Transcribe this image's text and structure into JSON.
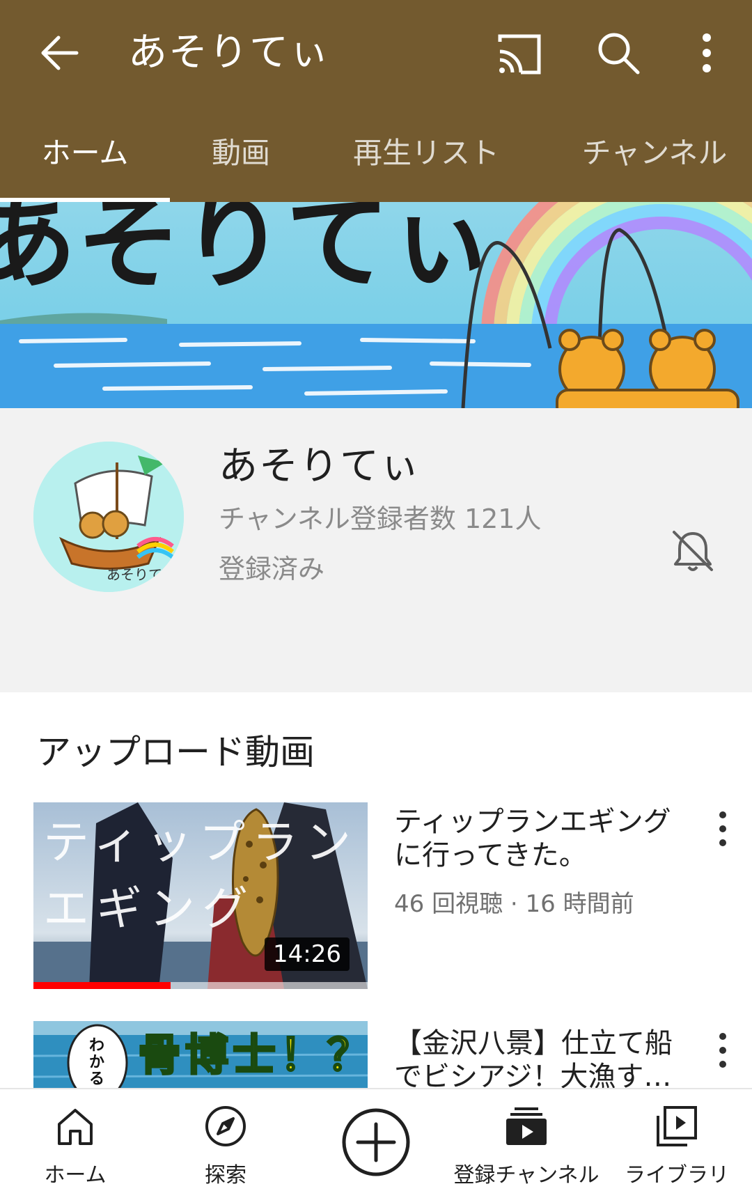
{
  "appbar": {
    "title": "あそりてぃ",
    "back_icon": "arrow-left-icon",
    "cast_icon": "cast-icon",
    "search_icon": "search-icon",
    "more_icon": "more-vert-icon",
    "bg_color": "#735a2f"
  },
  "tabs": [
    {
      "label": "ホーム",
      "active": true
    },
    {
      "label": "動画",
      "active": false
    },
    {
      "label": "再生リスト",
      "active": false
    },
    {
      "label": "チャンネル",
      "active": false
    }
  ],
  "banner": {
    "text": "あそりてぃ"
  },
  "channel": {
    "name": "あそりてぃ",
    "subscribers": "チャンネル登録者数 121人",
    "subscription_state": "登録済み",
    "bell_icon": "bell-off-icon",
    "avatar_text": "あそりてぃ"
  },
  "uploads": {
    "section_title": "アップロード動画",
    "videos": [
      {
        "title": "ティップランエギング に行ってきた。",
        "meta": "46 回視聴 · 16 時間前",
        "duration": "14:26",
        "thumb_text": "ティップラン エギング",
        "watched_fraction": 0.41
      },
      {
        "title": "【金沢八景】仕立て船でビシアジ！大漁す…",
        "meta": "",
        "thumb_text": "骨博士！？",
        "thumb_badge": "わかる"
      }
    ]
  },
  "bottom_nav": [
    {
      "label": "ホーム",
      "icon": "home-icon"
    },
    {
      "label": "探索",
      "icon": "explore-icon"
    },
    {
      "label": "",
      "icon": "add-circle-icon"
    },
    {
      "label": "登録チャンネル",
      "icon": "subscriptions-icon"
    },
    {
      "label": "ライブラリ",
      "icon": "library-icon"
    }
  ]
}
